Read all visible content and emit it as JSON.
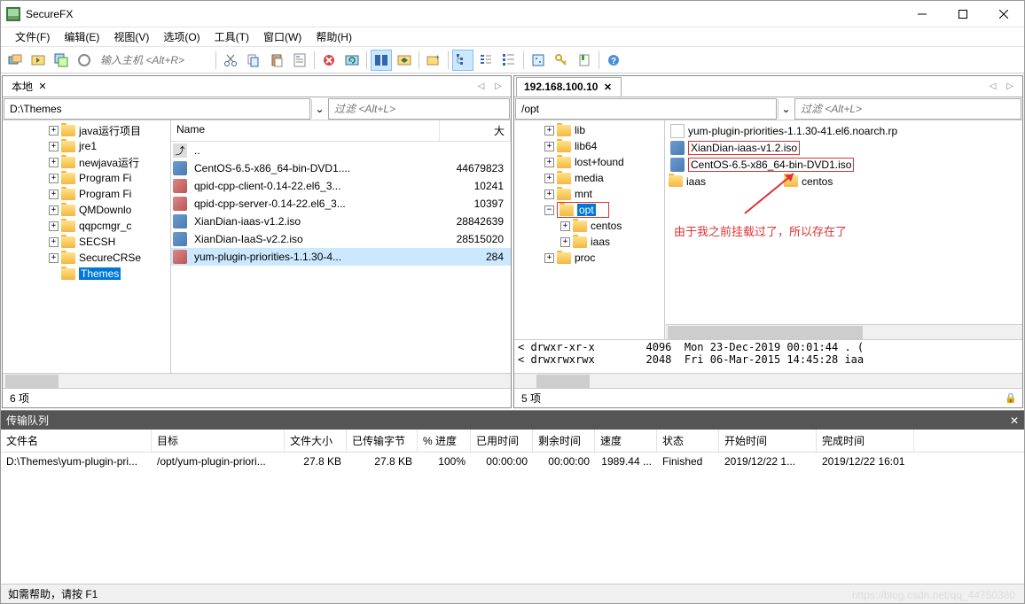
{
  "title": "SecureFX",
  "menu": [
    "文件(F)",
    "编辑(E)",
    "视图(V)",
    "选项(O)",
    "工具(T)",
    "窗口(W)",
    "帮助(H)"
  ],
  "toolbar_host_placeholder": "输入主机 <Alt+R>",
  "left": {
    "tab": "本地",
    "path": "D:\\Themes",
    "filter_ph": "过滤 <Alt+L>",
    "tree": [
      {
        "l": "java运行项目",
        "ind": 48
      },
      {
        "l": "jre1",
        "ind": 48
      },
      {
        "l": "newjava运行",
        "ind": 48
      },
      {
        "l": "Program Fi",
        "ind": 48
      },
      {
        "l": "Program Fi",
        "ind": 48
      },
      {
        "l": "QMDownlo",
        "ind": 48
      },
      {
        "l": "qqpcmgr_c",
        "ind": 48
      },
      {
        "l": "SECSH",
        "ind": 48
      },
      {
        "l": "SecureCRSe",
        "ind": 48
      },
      {
        "l": "Themes",
        "ind": 48,
        "sel": true,
        "notoggle": true
      }
    ],
    "cols": {
      "name": "Name",
      "size": "大"
    },
    "files": [
      {
        "n": "..",
        "s": "",
        "ic": "up"
      },
      {
        "n": "CentOS-6.5-x86_64-bin-DVD1....",
        "s": "44679823",
        "ic": "iso"
      },
      {
        "n": "qpid-cpp-client-0.14-22.el6_3...",
        "s": "10241",
        "ic": "rpm"
      },
      {
        "n": "qpid-cpp-server-0.14-22.el6_3...",
        "s": "10397",
        "ic": "rpm"
      },
      {
        "n": "XianDian-iaas-v1.2.iso",
        "s": "28842639",
        "ic": "iso"
      },
      {
        "n": "XianDian-IaaS-v2.2.iso",
        "s": "28515020",
        "ic": "iso"
      },
      {
        "n": "yum-plugin-priorities-1.1.30-4...",
        "s": "284",
        "ic": "rpm",
        "sel": true
      }
    ],
    "count": "6 项"
  },
  "right": {
    "tab": "192.168.100.10",
    "path": "/opt",
    "filter_ph": "过滤 <Alt+L>",
    "tree": [
      {
        "l": "lib",
        "ind": 30
      },
      {
        "l": "lib64",
        "ind": 30
      },
      {
        "l": "lost+found",
        "ind": 30
      },
      {
        "l": "media",
        "ind": 30
      },
      {
        "l": "mnt",
        "ind": 30
      },
      {
        "l": "opt",
        "ind": 30,
        "sel": true,
        "exp": true,
        "box": true
      },
      {
        "l": "centos",
        "ind": 48
      },
      {
        "l": "iaas",
        "ind": 48
      },
      {
        "l": "proc",
        "ind": 30
      }
    ],
    "files": [
      {
        "n": "yum-plugin-priorities-1.1.30-41.el6.noarch.rp",
        "ic": "doc"
      },
      {
        "n": "XianDian-iaas-v1.2.iso",
        "ic": "iso",
        "box": true
      },
      {
        "n": "CentOS-6.5-x86_64-bin-DVD1.iso",
        "ic": "iso",
        "box": true
      },
      {
        "n": "iaas",
        "ic": "folder"
      },
      {
        "n": "centos",
        "ic": "folder",
        "col2": true
      }
    ],
    "annotation": "由于我之前挂载过了，所以存在了",
    "details": "< drwxr-xr-x        4096  Mon 23-Dec-2019 00:01:44 . ( \n< drwxrwxrwx        2048  Fri 06-Mar-2015 14:45:28 iaa",
    "count": "5 项"
  },
  "queue": {
    "title": "传输队列",
    "cols": [
      "文件名",
      "目标",
      "文件大小",
      "已传输字节",
      "% 进度",
      "已用时间",
      "剩余时间",
      "速度",
      "状态",
      "开始时间",
      "完成时间"
    ],
    "row": [
      "D:\\Themes\\yum-plugin-pri...",
      "/opt/yum-plugin-priori...",
      "27.8 KB",
      "27.8 KB",
      "100%",
      "00:00:00",
      "00:00:00",
      "1989.44 ...",
      "Finished",
      "2019/12/22 1...",
      "2019/12/22 16:01"
    ]
  },
  "statusbar": "如需帮助，请按 F1",
  "watermark": "https://blog.csdn.net/qq_44750380",
  "qcolw": [
    170,
    150,
    70,
    80,
    60,
    70,
    70,
    70,
    70,
    110,
    110
  ],
  "icons": {
    "app": "app-icon",
    "min": "minimize",
    "max": "maximize",
    "close": "close",
    "cut": "cut-icon",
    "copy": "copy-icon",
    "paste": "paste-icon",
    "props": "properties-icon",
    "delete": "delete-icon",
    "sync": "sync-icon",
    "panes": "panes-icon",
    "options": "options-icon",
    "newfolder": "newfolder-icon",
    "tree": "tree-icon",
    "list": "list-icon",
    "details": "details-icon",
    "key": "key-icon",
    "bookmark": "bookmark-icon",
    "help": "help-icon",
    "refresh": "refresh-icon",
    "session": "session-icon",
    "quick": "quick-icon",
    "reconn": "reconnect-icon",
    "layout": "layout-icon"
  }
}
